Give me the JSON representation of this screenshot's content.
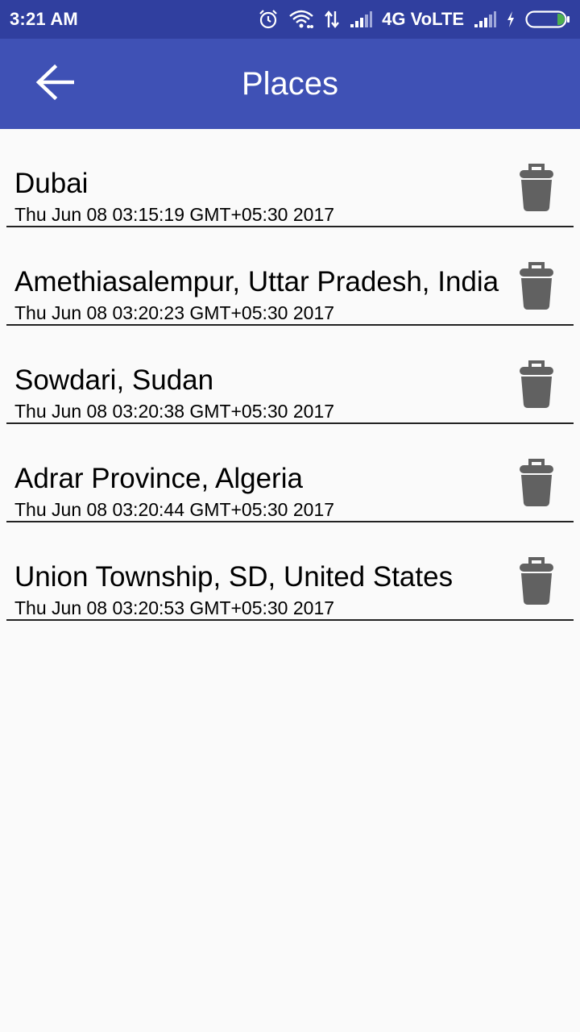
{
  "status_bar": {
    "time": "3:21 AM",
    "network_label": "4G VoLTE",
    "icons": [
      "alarm-icon",
      "wifi-icon",
      "data-arrows-icon",
      "signal-icon",
      "signal-icon",
      "charging-icon",
      "battery-icon"
    ],
    "battery_color": "#4CAF50"
  },
  "app_bar": {
    "title": "Places",
    "back_icon": "arrow-back-icon",
    "color": "#3F51B5",
    "status_color": "#303F9F"
  },
  "places": [
    {
      "name": "Dubai",
      "date": "Thu Jun 08 03:15:19 GMT+05:30 2017"
    },
    {
      "name": "Amethiasalempur, Uttar Pradesh, India",
      "date": "Thu Jun 08 03:20:23 GMT+05:30 2017"
    },
    {
      "name": "Sowdari, Sudan",
      "date": "Thu Jun 08 03:20:38 GMT+05:30 2017"
    },
    {
      "name": "Adrar Province, Algeria",
      "date": "Thu Jun 08 03:20:44 GMT+05:30 2017"
    },
    {
      "name": "Union Township, SD, United States",
      "date": "Thu Jun 08 03:20:53 GMT+05:30 2017"
    }
  ],
  "delete_icon": "trash-icon",
  "icon_color": "#616161"
}
